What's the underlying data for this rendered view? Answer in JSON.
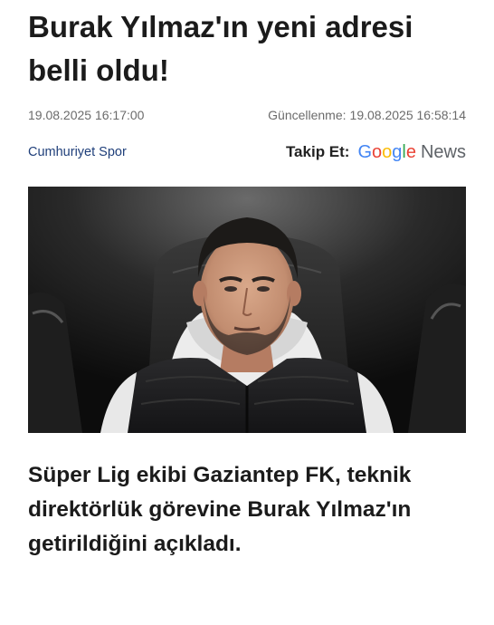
{
  "article": {
    "headline": "Burak Yılmaz'ın yeni adresi belli oldu!",
    "published": "19.08.2025 16:17:00",
    "updated_label": "Güncellenme:",
    "updated": "19.08.2025 16:58:14",
    "source": "Cumhuriyet Spor",
    "lede": "Süper Lig ekibi Gaziantep FK, teknik direktörlük görevine Burak Yılmaz'ın getirildiğini açıkladı."
  },
  "follow": {
    "label": "Takip Et:",
    "brand_letters": [
      "G",
      "o",
      "o",
      "g",
      "l",
      "e"
    ],
    "news": "News",
    "brand_colors": [
      "#4285F4",
      "#EA4335",
      "#FBBC05",
      "#4285F4",
      "#34A853",
      "#EA4335"
    ]
  },
  "colors": {
    "source_link": "#1f3f7a",
    "meta_text": "#6b6b6b",
    "headline": "#1b1b1b"
  }
}
